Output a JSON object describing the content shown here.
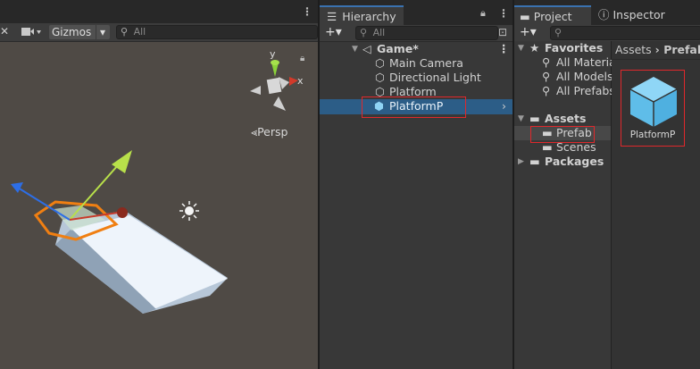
{
  "scene": {
    "gizmos_label": "Gizmos",
    "search_placeholder": "All",
    "persp_label": "Persp",
    "axis_y": "y",
    "axis_x": "x"
  },
  "hierarchy": {
    "tab_label": "Hierarchy",
    "search_placeholder": "All",
    "scene_name": "Game*",
    "items": [
      {
        "label": "Main Camera"
      },
      {
        "label": "Directional Light"
      },
      {
        "label": "Platform"
      },
      {
        "label": "PlatformP"
      }
    ]
  },
  "project": {
    "tab_project": "Project",
    "tab_inspector": "Inspector",
    "tree": {
      "favorites": "Favorites",
      "fav_items": [
        "All Materia",
        "All Models",
        "All Prefabs"
      ],
      "assets": "Assets",
      "asset_items": [
        "Prefab",
        "Scenes"
      ],
      "packages": "Packages"
    },
    "breadcrumb_root": "Assets",
    "breadcrumb_current": "Prefab",
    "asset_tile_label": "PlatformP"
  },
  "colors": {
    "selection": "#2c5d87",
    "highlight": "#e0282c",
    "prefab_blue": "#6ec5ef"
  }
}
